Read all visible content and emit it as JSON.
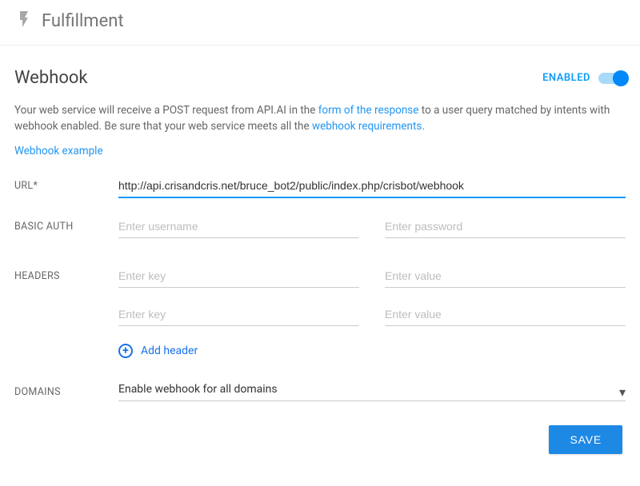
{
  "header": {
    "title": "Fulfillment"
  },
  "section": {
    "title": "Webhook",
    "enabled_label": "ENABLED"
  },
  "description": {
    "pre": "Your web service will receive a POST request from API.AI in the ",
    "link1": "form of the response",
    "mid": " to a user query matched by intents with webhook enabled. Be sure that your web service meets all the ",
    "link2": "webhook requirements",
    "post": "."
  },
  "example_link": "Webhook example",
  "fields": {
    "url_label": "URL*",
    "url_value": "http://api.crisandcris.net/bruce_bot2/public/index.php/crisbot/webhook",
    "basic_auth_label": "BASIC AUTH",
    "username_placeholder": "Enter username",
    "password_placeholder": "Enter password",
    "headers_label": "HEADERS",
    "key_placeholder": "Enter key",
    "value_placeholder": "Enter value",
    "add_header": "Add header",
    "domains_label": "DOMAINS",
    "domains_value": "Enable webhook for all domains"
  },
  "buttons": {
    "save": "SAVE"
  }
}
